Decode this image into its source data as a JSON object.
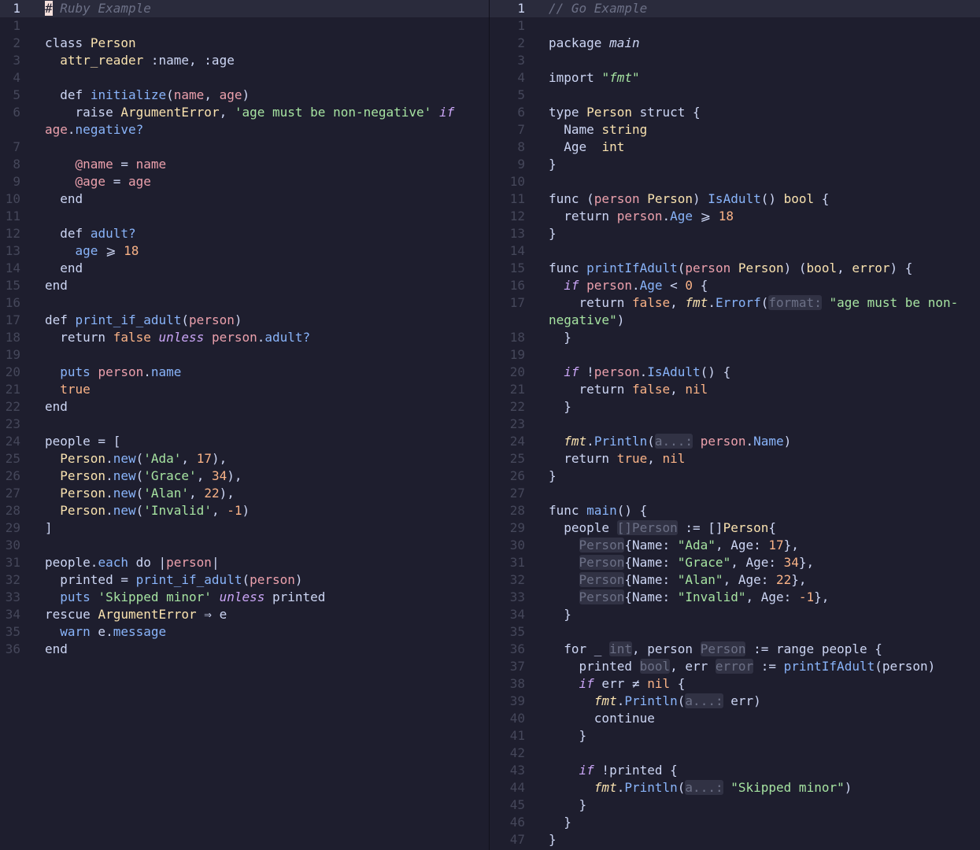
{
  "left": {
    "lines": [
      {
        "n": "1",
        "cur": true,
        "html": "<span class=\"caret\">#</span><span class=\"c\"> Ruby Example</span>"
      },
      {
        "n": "1",
        "html": ""
      },
      {
        "n": "2",
        "html": "<span class=\"kw\">class</span> <span class=\"t\">Person</span>"
      },
      {
        "n": "3",
        "html": "  <span class=\"t\">attr_reader</span> :name, :age"
      },
      {
        "n": "4",
        "html": ""
      },
      {
        "n": "5",
        "html": "  <span class=\"kw\">def</span> <span class=\"f\">initialize</span>(<span class=\"v\">name</span>, <span class=\"v\">age</span>)"
      },
      {
        "n": "6",
        "html": "    <span class=\"kw\">raise</span> <span class=\"t\">ArgumentError</span>, <span class=\"s\">'age must be non-negative'</span> <span class=\"k i\">if</span>"
      },
      {
        "n": "",
        "html": "<span class=\"v\">age</span>.<span class=\"f\">negative?</span>"
      },
      {
        "n": "7",
        "html": ""
      },
      {
        "n": "8",
        "html": "    <span class=\"v\">@name</span> = <span class=\"v\">name</span>"
      },
      {
        "n": "9",
        "html": "    <span class=\"v\">@age</span> = <span class=\"v\">age</span>"
      },
      {
        "n": "10",
        "html": "  <span class=\"kw\">end</span>"
      },
      {
        "n": "11",
        "html": ""
      },
      {
        "n": "12",
        "html": "  <span class=\"kw\">def</span> <span class=\"f\">adult?</span>"
      },
      {
        "n": "13",
        "html": "    <span class=\"f\">age</span> ⩾ <span class=\"n\">18</span>"
      },
      {
        "n": "14",
        "html": "  <span class=\"kw\">end</span>"
      },
      {
        "n": "15",
        "html": "<span class=\"kw\">end</span>"
      },
      {
        "n": "16",
        "html": ""
      },
      {
        "n": "17",
        "html": "<span class=\"kw\">def</span> <span class=\"f\">print_if_adult</span>(<span class=\"v\">person</span>)"
      },
      {
        "n": "18",
        "html": "  <span class=\"kw\">return</span> <span class=\"n\">false</span> <span class=\"k i\">unless</span> <span class=\"v\">person</span>.<span class=\"f\">adult?</span>"
      },
      {
        "n": "19",
        "html": ""
      },
      {
        "n": "20",
        "html": "  <span class=\"f\">puts</span> <span class=\"v\">person</span>.<span class=\"f\">name</span>"
      },
      {
        "n": "21",
        "html": "  <span class=\"n\">true</span>"
      },
      {
        "n": "22",
        "html": "<span class=\"kw\">end</span>"
      },
      {
        "n": "23",
        "html": ""
      },
      {
        "n": "24",
        "html": "people = ["
      },
      {
        "n": "25",
        "html": "  <span class=\"t\">Person</span>.<span class=\"f\">new</span>(<span class=\"s\">'Ada'</span>, <span class=\"n\">17</span>),"
      },
      {
        "n": "26",
        "html": "  <span class=\"t\">Person</span>.<span class=\"f\">new</span>(<span class=\"s\">'Grace'</span>, <span class=\"n\">34</span>),"
      },
      {
        "n": "27",
        "html": "  <span class=\"t\">Person</span>.<span class=\"f\">new</span>(<span class=\"s\">'Alan'</span>, <span class=\"n\">22</span>),"
      },
      {
        "n": "28",
        "html": "  <span class=\"t\">Person</span>.<span class=\"f\">new</span>(<span class=\"s\">'Invalid'</span>, <span class=\"n\">-1</span>)"
      },
      {
        "n": "29",
        "html": "]"
      },
      {
        "n": "30",
        "html": ""
      },
      {
        "n": "31",
        "html": "people.<span class=\"f\">each</span> <span class=\"kw\">do</span> |<span class=\"v\">person</span>|"
      },
      {
        "n": "32",
        "html": "  printed = <span class=\"f\">print_if_adult</span>(<span class=\"v\">person</span>)"
      },
      {
        "n": "33",
        "html": "  <span class=\"f\">puts</span> <span class=\"s\">'Skipped minor'</span> <span class=\"k i\">unless</span> printed"
      },
      {
        "n": "34",
        "html": "<span class=\"kw\">rescue</span> <span class=\"t\">ArgumentError</span> ⇒ e"
      },
      {
        "n": "35",
        "html": "  <span class=\"f\">warn</span> e.<span class=\"f\">message</span>"
      },
      {
        "n": "36",
        "html": "<span class=\"kw\">end</span>"
      }
    ]
  },
  "right": {
    "lines": [
      {
        "n": "1",
        "cur": true,
        "html": "<span class=\"c\">// Go Example</span>"
      },
      {
        "n": "1",
        "html": ""
      },
      {
        "n": "2",
        "html": "<span class=\"kw\">package</span> <span class=\"i\">main</span>"
      },
      {
        "n": "3",
        "html": ""
      },
      {
        "n": "4",
        "html": "<span class=\"kw\">import</span> <span class=\"s\">\"<i>fmt</i>\"</span>"
      },
      {
        "n": "5",
        "html": ""
      },
      {
        "n": "6",
        "html": "<span class=\"kw\">type</span> <span class=\"t\">Person</span> <span class=\"kw\">struct</span> {"
      },
      {
        "n": "7",
        "html": "  Name <span class=\"t\">string</span>"
      },
      {
        "n": "8",
        "html": "  Age  <span class=\"t\">int</span>"
      },
      {
        "n": "9",
        "html": "}"
      },
      {
        "n": "10",
        "html": ""
      },
      {
        "n": "11",
        "html": "<span class=\"kw\">func</span> (<span class=\"v\">person</span> <span class=\"t\">Person</span>) <span class=\"f\">IsAdult</span>() <span class=\"t\">bool</span> {"
      },
      {
        "n": "12",
        "html": "  <span class=\"kw\">return</span> <span class=\"v\">person</span>.<span class=\"f\">Age</span> ⩾ <span class=\"n\">18</span>"
      },
      {
        "n": "13",
        "html": "}"
      },
      {
        "n": "14",
        "html": ""
      },
      {
        "n": "15",
        "html": "<span class=\"kw\">func</span> <span class=\"f\">printIfAdult</span>(<span class=\"v\">person</span> <span class=\"t\">Person</span>) (<span class=\"t\">bool</span>, <span class=\"t\">error</span>) {"
      },
      {
        "n": "16",
        "html": "  <span class=\"k i\">if</span> <span class=\"v\">person</span>.<span class=\"f\">Age</span> &lt; <span class=\"n\">0</span> {"
      },
      {
        "n": "17",
        "html": "    <span class=\"kw\">return</span> <span class=\"n\">false</span>, <span class=\"t i\">fmt</span>.<span class=\"f\">Errorf</span>(<span class=\"hint\">format:</span> <span class=\"s\">\"age must be non-</span>"
      },
      {
        "n": "",
        "html": "<span class=\"s\">negative\"</span>)"
      },
      {
        "n": "18",
        "html": "  }"
      },
      {
        "n": "19",
        "html": ""
      },
      {
        "n": "20",
        "html": "  <span class=\"k i\">if</span> !<span class=\"v\">person</span>.<span class=\"f\">IsAdult</span>() {"
      },
      {
        "n": "21",
        "html": "    <span class=\"kw\">return</span> <span class=\"n\">false</span>, <span class=\"n\">nil</span>"
      },
      {
        "n": "22",
        "html": "  }"
      },
      {
        "n": "23",
        "html": ""
      },
      {
        "n": "24",
        "html": "  <span class=\"t i\">fmt</span>.<span class=\"f\">Println</span>(<span class=\"hint\">a...:</span> <span class=\"v\">person</span>.<span class=\"f\">Name</span>)"
      },
      {
        "n": "25",
        "html": "  <span class=\"kw\">return</span> <span class=\"n\">true</span>, <span class=\"n\">nil</span>"
      },
      {
        "n": "26",
        "html": "}"
      },
      {
        "n": "27",
        "html": ""
      },
      {
        "n": "28",
        "html": "<span class=\"kw\">func</span> <span class=\"f\">main</span>() {"
      },
      {
        "n": "29",
        "html": "  people <span class=\"hint\">[]Person</span> := []<span class=\"t\">Person</span>{"
      },
      {
        "n": "30",
        "html": "    <span class=\"hint\">Person</span>{Name: <span class=\"s\">\"Ada\"</span>, Age: <span class=\"n\">17</span>},"
      },
      {
        "n": "31",
        "html": "    <span class=\"hint\">Person</span>{Name: <span class=\"s\">\"Grace\"</span>, Age: <span class=\"n\">34</span>},"
      },
      {
        "n": "32",
        "html": "    <span class=\"hint\">Person</span>{Name: <span class=\"s\">\"Alan\"</span>, Age: <span class=\"n\">22</span>},"
      },
      {
        "n": "33",
        "html": "    <span class=\"hint\">Person</span>{Name: <span class=\"s\">\"Invalid\"</span>, Age: <span class=\"n\">-1</span>},"
      },
      {
        "n": "34",
        "html": "  }"
      },
      {
        "n": "35",
        "html": ""
      },
      {
        "n": "36",
        "html": "  <span class=\"kw\">for</span> _ <span class=\"hint\">int</span>, person <span class=\"hint\">Person</span> := <span class=\"kw\">range</span> people {"
      },
      {
        "n": "37",
        "html": "    printed <span class=\"hint\">bool</span>, err <span class=\"hint\">error</span> := <span class=\"f\">printIfAdult</span>(person)"
      },
      {
        "n": "38",
        "html": "    <span class=\"k i\">if</span> err ≠ <span class=\"n\">nil</span> {"
      },
      {
        "n": "39",
        "html": "      <span class=\"t i\">fmt</span>.<span class=\"f\">Println</span>(<span class=\"hint\">a...:</span> err)"
      },
      {
        "n": "40",
        "html": "      <span class=\"kw\">continue</span>"
      },
      {
        "n": "41",
        "html": "    }"
      },
      {
        "n": "42",
        "html": ""
      },
      {
        "n": "43",
        "html": "    <span class=\"k i\">if</span> !printed {"
      },
      {
        "n": "44",
        "html": "      <span class=\"t i\">fmt</span>.<span class=\"f\">Println</span>(<span class=\"hint\">a...:</span> <span class=\"s\">\"Skipped minor\"</span>)"
      },
      {
        "n": "45",
        "html": "    }"
      },
      {
        "n": "46",
        "html": "  }"
      },
      {
        "n": "47",
        "html": "}"
      }
    ]
  }
}
